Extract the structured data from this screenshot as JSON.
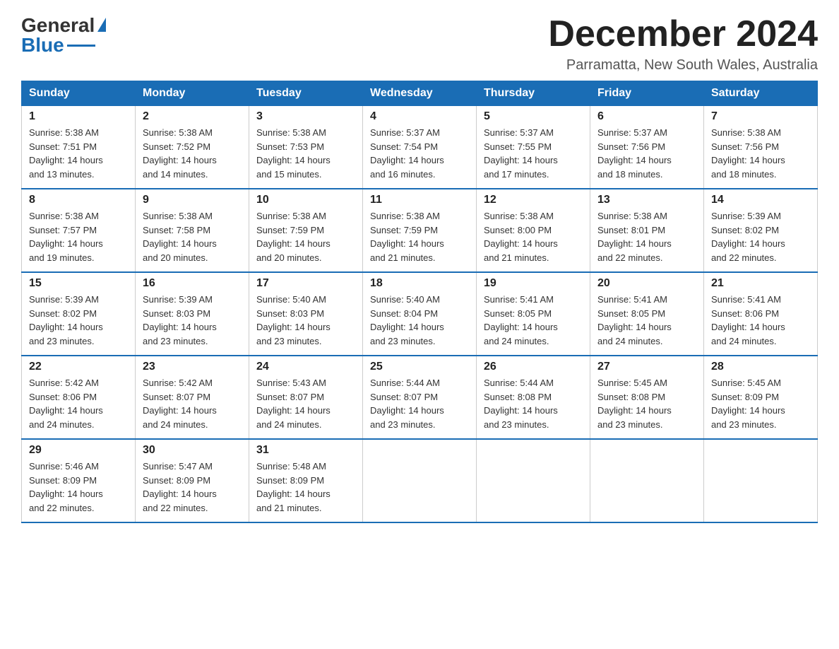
{
  "header": {
    "logo_general": "General",
    "logo_blue": "Blue",
    "month_title": "December 2024",
    "subtitle": "Parramatta, New South Wales, Australia"
  },
  "days_of_week": [
    "Sunday",
    "Monday",
    "Tuesday",
    "Wednesday",
    "Thursday",
    "Friday",
    "Saturday"
  ],
  "weeks": [
    [
      {
        "day": "1",
        "sunrise": "5:38 AM",
        "sunset": "7:51 PM",
        "daylight": "14 hours and 13 minutes."
      },
      {
        "day": "2",
        "sunrise": "5:38 AM",
        "sunset": "7:52 PM",
        "daylight": "14 hours and 14 minutes."
      },
      {
        "day": "3",
        "sunrise": "5:38 AM",
        "sunset": "7:53 PM",
        "daylight": "14 hours and 15 minutes."
      },
      {
        "day": "4",
        "sunrise": "5:37 AM",
        "sunset": "7:54 PM",
        "daylight": "14 hours and 16 minutes."
      },
      {
        "day": "5",
        "sunrise": "5:37 AM",
        "sunset": "7:55 PM",
        "daylight": "14 hours and 17 minutes."
      },
      {
        "day": "6",
        "sunrise": "5:37 AM",
        "sunset": "7:56 PM",
        "daylight": "14 hours and 18 minutes."
      },
      {
        "day": "7",
        "sunrise": "5:38 AM",
        "sunset": "7:56 PM",
        "daylight": "14 hours and 18 minutes."
      }
    ],
    [
      {
        "day": "8",
        "sunrise": "5:38 AM",
        "sunset": "7:57 PM",
        "daylight": "14 hours and 19 minutes."
      },
      {
        "day": "9",
        "sunrise": "5:38 AM",
        "sunset": "7:58 PM",
        "daylight": "14 hours and 20 minutes."
      },
      {
        "day": "10",
        "sunrise": "5:38 AM",
        "sunset": "7:59 PM",
        "daylight": "14 hours and 20 minutes."
      },
      {
        "day": "11",
        "sunrise": "5:38 AM",
        "sunset": "7:59 PM",
        "daylight": "14 hours and 21 minutes."
      },
      {
        "day": "12",
        "sunrise": "5:38 AM",
        "sunset": "8:00 PM",
        "daylight": "14 hours and 21 minutes."
      },
      {
        "day": "13",
        "sunrise": "5:38 AM",
        "sunset": "8:01 PM",
        "daylight": "14 hours and 22 minutes."
      },
      {
        "day": "14",
        "sunrise": "5:39 AM",
        "sunset": "8:02 PM",
        "daylight": "14 hours and 22 minutes."
      }
    ],
    [
      {
        "day": "15",
        "sunrise": "5:39 AM",
        "sunset": "8:02 PM",
        "daylight": "14 hours and 23 minutes."
      },
      {
        "day": "16",
        "sunrise": "5:39 AM",
        "sunset": "8:03 PM",
        "daylight": "14 hours and 23 minutes."
      },
      {
        "day": "17",
        "sunrise": "5:40 AM",
        "sunset": "8:03 PM",
        "daylight": "14 hours and 23 minutes."
      },
      {
        "day": "18",
        "sunrise": "5:40 AM",
        "sunset": "8:04 PM",
        "daylight": "14 hours and 23 minutes."
      },
      {
        "day": "19",
        "sunrise": "5:41 AM",
        "sunset": "8:05 PM",
        "daylight": "14 hours and 24 minutes."
      },
      {
        "day": "20",
        "sunrise": "5:41 AM",
        "sunset": "8:05 PM",
        "daylight": "14 hours and 24 minutes."
      },
      {
        "day": "21",
        "sunrise": "5:41 AM",
        "sunset": "8:06 PM",
        "daylight": "14 hours and 24 minutes."
      }
    ],
    [
      {
        "day": "22",
        "sunrise": "5:42 AM",
        "sunset": "8:06 PM",
        "daylight": "14 hours and 24 minutes."
      },
      {
        "day": "23",
        "sunrise": "5:42 AM",
        "sunset": "8:07 PM",
        "daylight": "14 hours and 24 minutes."
      },
      {
        "day": "24",
        "sunrise": "5:43 AM",
        "sunset": "8:07 PM",
        "daylight": "14 hours and 24 minutes."
      },
      {
        "day": "25",
        "sunrise": "5:44 AM",
        "sunset": "8:07 PM",
        "daylight": "14 hours and 23 minutes."
      },
      {
        "day": "26",
        "sunrise": "5:44 AM",
        "sunset": "8:08 PM",
        "daylight": "14 hours and 23 minutes."
      },
      {
        "day": "27",
        "sunrise": "5:45 AM",
        "sunset": "8:08 PM",
        "daylight": "14 hours and 23 minutes."
      },
      {
        "day": "28",
        "sunrise": "5:45 AM",
        "sunset": "8:09 PM",
        "daylight": "14 hours and 23 minutes."
      }
    ],
    [
      {
        "day": "29",
        "sunrise": "5:46 AM",
        "sunset": "8:09 PM",
        "daylight": "14 hours and 22 minutes."
      },
      {
        "day": "30",
        "sunrise": "5:47 AM",
        "sunset": "8:09 PM",
        "daylight": "14 hours and 22 minutes."
      },
      {
        "day": "31",
        "sunrise": "5:48 AM",
        "sunset": "8:09 PM",
        "daylight": "14 hours and 21 minutes."
      },
      null,
      null,
      null,
      null
    ]
  ],
  "labels": {
    "sunrise": "Sunrise:",
    "sunset": "Sunset:",
    "daylight": "Daylight:"
  }
}
